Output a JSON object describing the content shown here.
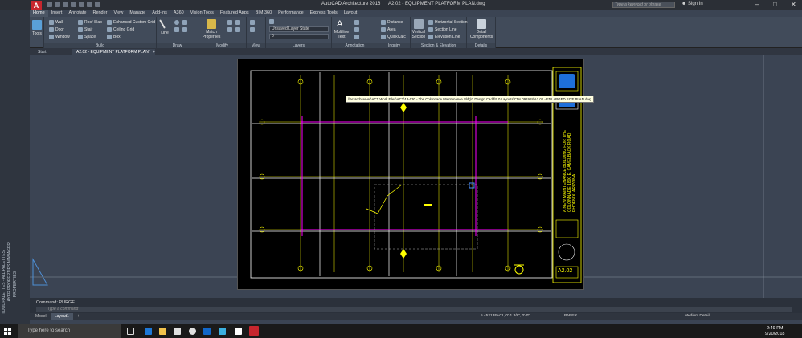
{
  "window": {
    "app_name": "AutoCAD Architecture 2016",
    "file_name": "A2.02 - EQUIPMENT PLATFORM PLAN.dwg",
    "search_placeholder": "Type a keyword or phrase",
    "signin_label": "Sign In"
  },
  "ribbon": {
    "tabs": [
      "Home",
      "Insert",
      "Annotate",
      "Render",
      "View",
      "Manage",
      "Add-ins",
      "A360",
      "Vision Tools",
      "Featured Apps",
      "BIM 360",
      "Performance",
      "Express Tools",
      "Layout"
    ],
    "active_tab": "Home",
    "tools_label": "Tools",
    "build": {
      "wall": "Wall",
      "door": "Door",
      "window": "Window",
      "roof_slab": "Roof Slab",
      "stair": "Stair",
      "space": "Space",
      "enhanced_grid": "Enhanced Custom Grid",
      "ceiling_grid": "Ceiling Grid",
      "box": "Box",
      "title": "Build"
    },
    "draw": {
      "line": "Line",
      "title": "Draw"
    },
    "modify": {
      "match_properties": "Match Properties",
      "title": "Modify"
    },
    "view": {
      "title": "View"
    },
    "layers": {
      "layer_state": "Unsaved Layer State",
      "current_layer": "0",
      "title": "Layers"
    },
    "annotation": {
      "multiline_text": "Multiline Text",
      "title": "Annotation"
    },
    "inquiry": {
      "distance": "Distance",
      "area": "Area",
      "quickcalc": "QuickCalc",
      "title": "Inquiry"
    },
    "section": {
      "vertical_section": "Vertical Section",
      "horizontal_section": "Horizontal Section",
      "section_line": "Section Line",
      "elevation_line": "Elevation Line",
      "title": "Section & Elevation"
    },
    "details": {
      "detail_components": "Detail Components",
      "title": "Details"
    }
  },
  "doc_tabs": [
    "Start",
    "A2.02 - EQUIPMENT PLATFORM PLAN*"
  ],
  "palettes": [
    "TOOL PALETTES - ALL PALETTES",
    "LAYER PROPERTIES MANAGER",
    "PROPERTIES"
  ],
  "tooltip": "\\\\actarchserver\\ACT Work Files\\ACT\\18-030 - The Colonnade Maintenance Bldg\\3 Design Cadd\\5.0 Layouts\\CDs 091918\\A1.02 - ENLARGED SITE PLAN.dwg",
  "titleblock": {
    "project_text": "A NEW MAINTENANCE BUILDING FOR THE COLONNADE 1800 E. CAMELBACK ROAD PHOENIX, ARIZONA",
    "sheet_number": "A2.02"
  },
  "command": {
    "history": "Command: PURGE",
    "placeholder": "Type a command"
  },
  "layout_tabs": [
    "Model",
    "Layout1"
  ],
  "status": {
    "coordinates": "5.45213E+01, 0'-1 3/8\", 0'-0\"",
    "space": "PAPER",
    "detail_level": "Medium Detail"
  },
  "taskbar": {
    "search_placeholder": "Type here to search",
    "time": "2:49 PM",
    "date": "9/20/2018"
  },
  "colors": {
    "accent_red": "#c6262e",
    "drawing_yellow": "#ffff00",
    "drawing_magenta": "#ff00ff",
    "titleblock_blue": "#1e6fd9"
  }
}
